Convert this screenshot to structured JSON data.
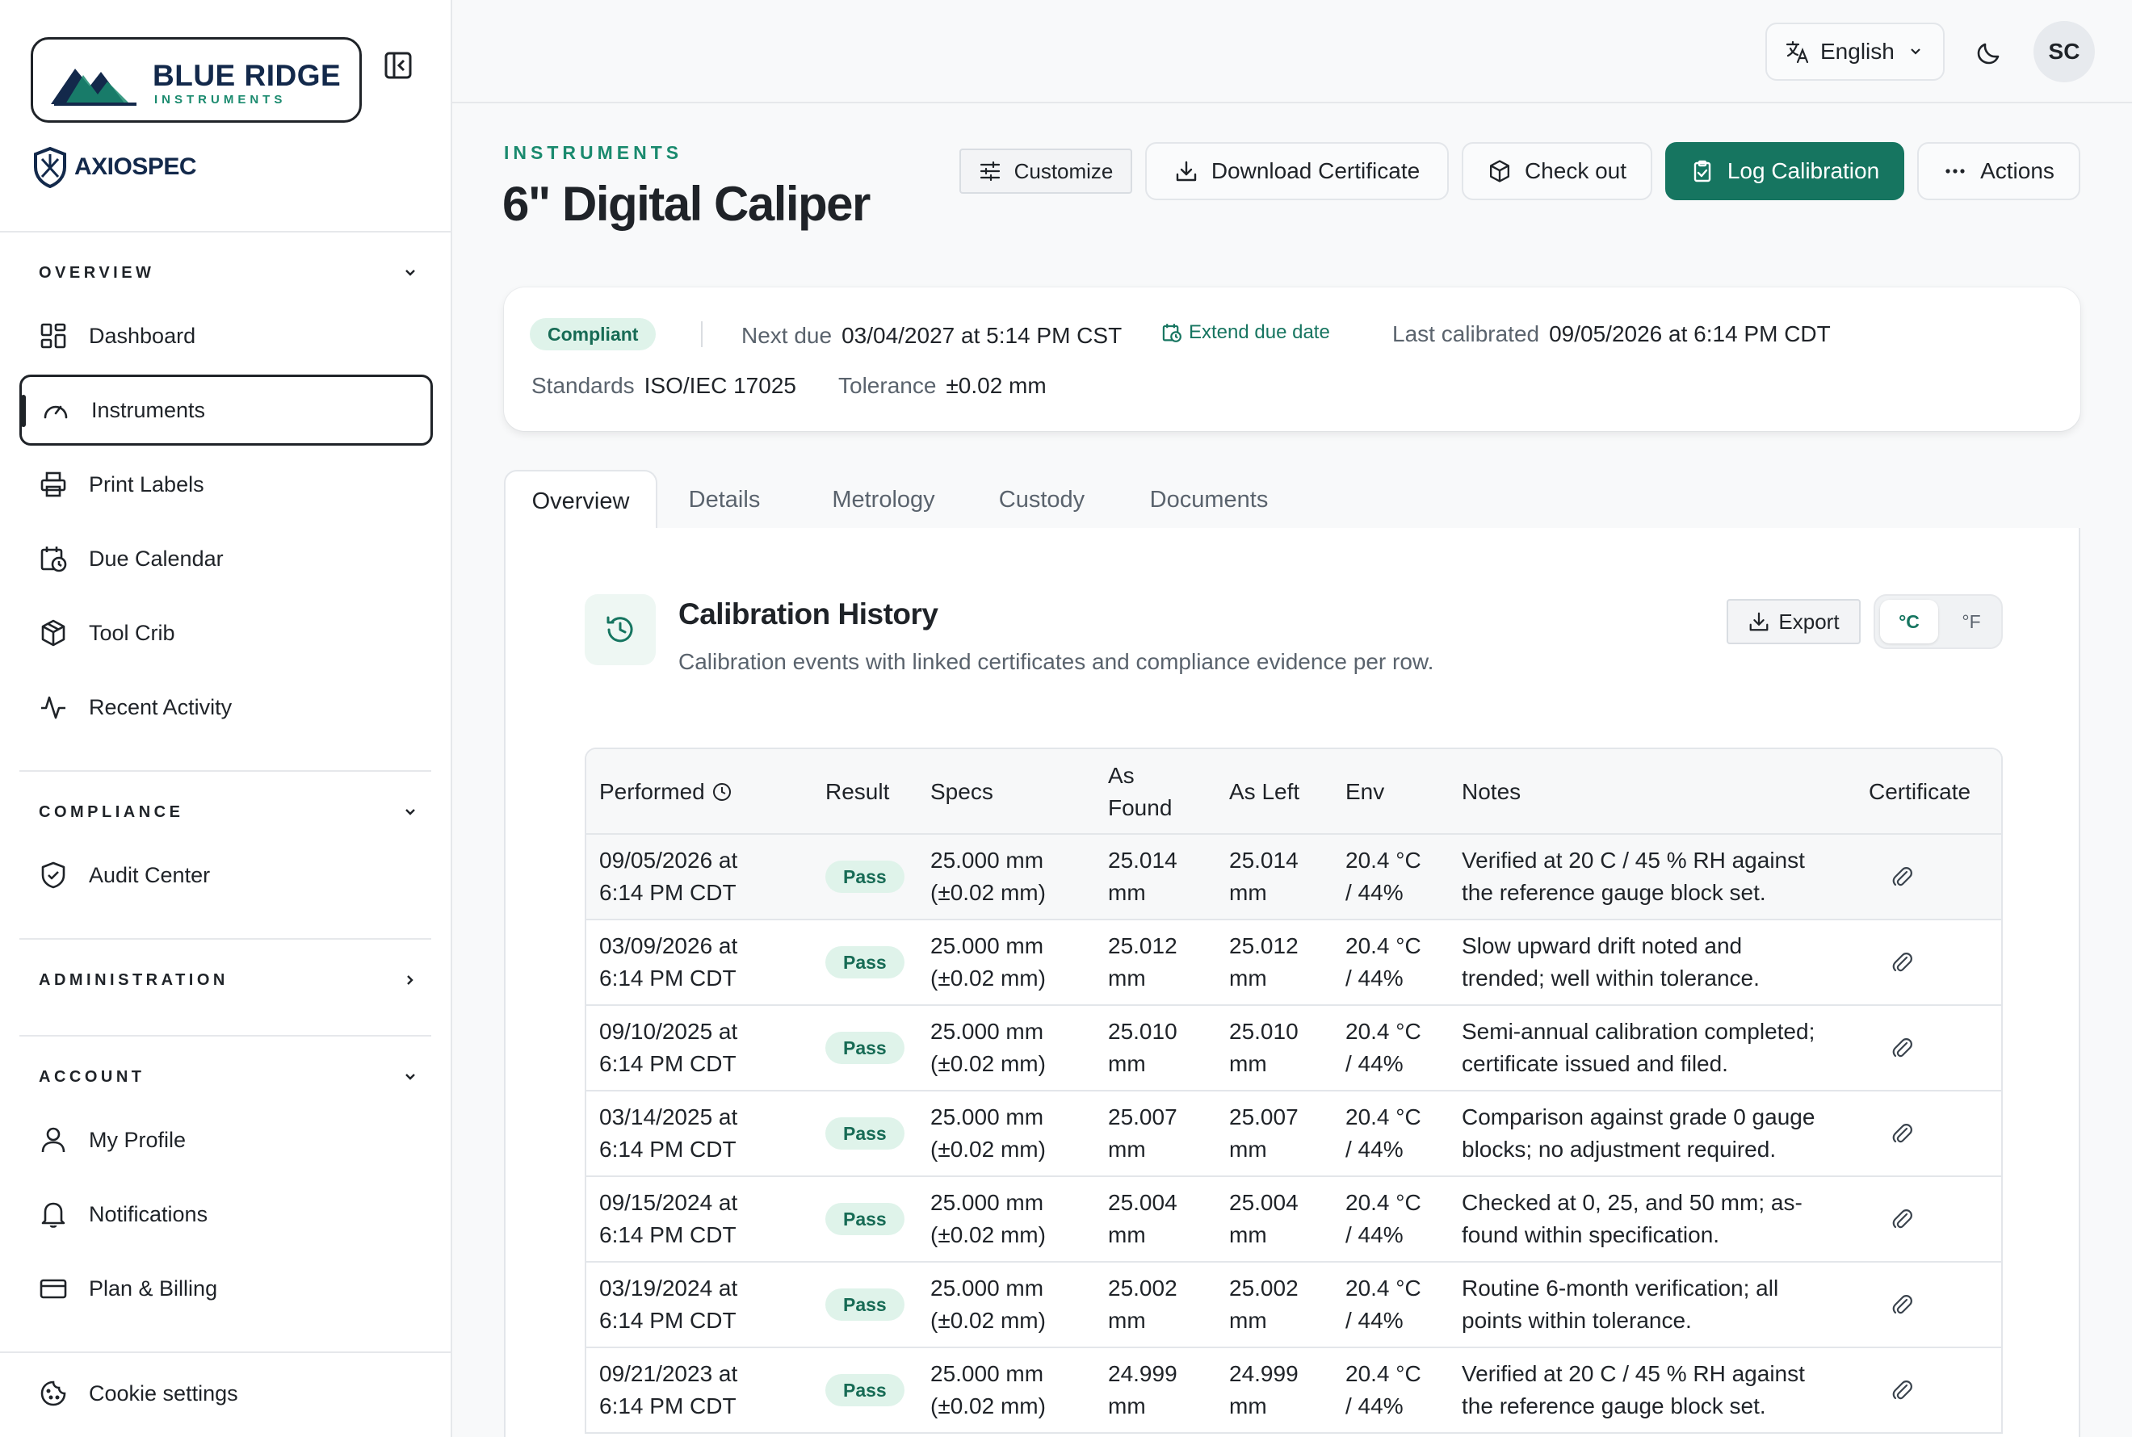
{
  "brand": {
    "name": "BLUE RIDGE",
    "sub": "INSTRUMENTS",
    "product": "AXIOSPEC"
  },
  "sidebar": {
    "overview_title": "OVERVIEW",
    "overview_items": [
      {
        "label": "Dashboard",
        "icon": "dashboard-icon"
      },
      {
        "label": "Instruments",
        "icon": "gauge-icon",
        "active": true
      },
      {
        "label": "Print Labels",
        "icon": "printer-icon"
      },
      {
        "label": "Due Calendar",
        "icon": "calendar-clock-icon"
      },
      {
        "label": "Tool Crib",
        "icon": "package-icon"
      },
      {
        "label": "Recent Activity",
        "icon": "activity-icon"
      }
    ],
    "compliance_title": "COMPLIANCE",
    "compliance_items": [
      {
        "label": "Audit Center",
        "icon": "shield-check-icon"
      }
    ],
    "administration_title": "ADMINISTRATION",
    "account_title": "ACCOUNT",
    "account_items": [
      {
        "label": "My Profile",
        "icon": "user-icon"
      },
      {
        "label": "Notifications",
        "icon": "bell-icon"
      },
      {
        "label": "Plan & Billing",
        "icon": "credit-card-icon"
      }
    ],
    "cookie_label": "Cookie settings"
  },
  "topbar": {
    "language": "English",
    "avatar_initials": "SC"
  },
  "header": {
    "eyebrow": "INSTRUMENTS",
    "title": "6\" Digital Caliper",
    "buttons": {
      "customize": "Customize",
      "download": "Download Certificate",
      "checkout": "Check out",
      "log": "Log Calibration",
      "actions": "Actions"
    }
  },
  "status": {
    "badge": "Compliant",
    "next_due_label": "Next due",
    "next_due_value": "03/04/2027 at 5:14 PM CST",
    "extend_label": "Extend due date",
    "last_cal_label": "Last calibrated",
    "last_cal_value": "09/05/2026 at 6:14 PM CDT",
    "standards_label": "Standards",
    "standards_value": "ISO/IEC 17025",
    "tolerance_label": "Tolerance",
    "tolerance_value": "±0.02 mm"
  },
  "tabs": [
    "Overview",
    "Details",
    "Metrology",
    "Custody",
    "Documents"
  ],
  "history": {
    "title": "Calibration History",
    "subtitle": "Calibration events with linked certificates and compliance evidence per row.",
    "export_label": "Export",
    "unit_c": "°C",
    "unit_f": "°F",
    "columns": {
      "performed": "Performed",
      "result": "Result",
      "specs": "Specs",
      "as_found_1": "As",
      "as_found_2": "Found",
      "as_left": "As Left",
      "env": "Env",
      "notes": "Notes",
      "certificate": "Certificate"
    },
    "rows": [
      {
        "date": "09/05/2026 at",
        "time": "6:14 PM CDT",
        "result": "Pass",
        "spec": "25.000 mm",
        "tol": "(±0.02 mm)",
        "found": "25.014",
        "left": "25.014",
        "unit": "mm",
        "env1": "20.4 °C",
        "env2": "/ 44%",
        "note1": "Verified at 20 C / 45 % RH against",
        "note2": "the reference gauge block set."
      },
      {
        "date": "03/09/2026 at",
        "time": "6:14 PM CDT",
        "result": "Pass",
        "spec": "25.000 mm",
        "tol": "(±0.02 mm)",
        "found": "25.012",
        "left": "25.012",
        "unit": "mm",
        "env1": "20.4 °C",
        "env2": "/ 44%",
        "note1": "Slow upward drift noted and",
        "note2": "trended; well within tolerance."
      },
      {
        "date": "09/10/2025 at",
        "time": "6:14 PM CDT",
        "result": "Pass",
        "spec": "25.000 mm",
        "tol": "(±0.02 mm)",
        "found": "25.010",
        "left": "25.010",
        "unit": "mm",
        "env1": "20.4 °C",
        "env2": "/ 44%",
        "note1": "Semi-annual calibration completed;",
        "note2": "certificate issued and filed."
      },
      {
        "date": "03/14/2025 at",
        "time": "6:14 PM CDT",
        "result": "Pass",
        "spec": "25.000 mm",
        "tol": "(±0.02 mm)",
        "found": "25.007",
        "left": "25.007",
        "unit": "mm",
        "env1": "20.4 °C",
        "env2": "/ 44%",
        "note1": "Comparison against grade 0 gauge",
        "note2": "blocks; no adjustment required."
      },
      {
        "date": "09/15/2024 at",
        "time": "6:14 PM CDT",
        "result": "Pass",
        "spec": "25.000 mm",
        "tol": "(±0.02 mm)",
        "found": "25.004",
        "left": "25.004",
        "unit": "mm",
        "env1": "20.4 °C",
        "env2": "/ 44%",
        "note1": "Checked at 0, 25, and 50 mm; as-",
        "note2": "found within specification."
      },
      {
        "date": "03/19/2024 at",
        "time": "6:14 PM CDT",
        "result": "Pass",
        "spec": "25.000 mm",
        "tol": "(±0.02 mm)",
        "found": "25.002",
        "left": "25.002",
        "unit": "mm",
        "env1": "20.4 °C",
        "env2": "/ 44%",
        "note1": "Routine 6-month verification; all",
        "note2": "points within tolerance."
      },
      {
        "date": "09/21/2023 at",
        "time": "6:14 PM CDT",
        "result": "Pass",
        "spec": "25.000 mm",
        "tol": "(±0.02 mm)",
        "found": "24.999",
        "left": "24.999",
        "unit": "mm",
        "env1": "20.4 °C",
        "env2": "/ 44%",
        "note1": "Verified at 20 C / 45 % RH against",
        "note2": "the reference gauge block set."
      }
    ]
  },
  "colors": {
    "accent": "#167560",
    "brand_navy": "#13294b",
    "pass_bg": "#dff3ea"
  }
}
